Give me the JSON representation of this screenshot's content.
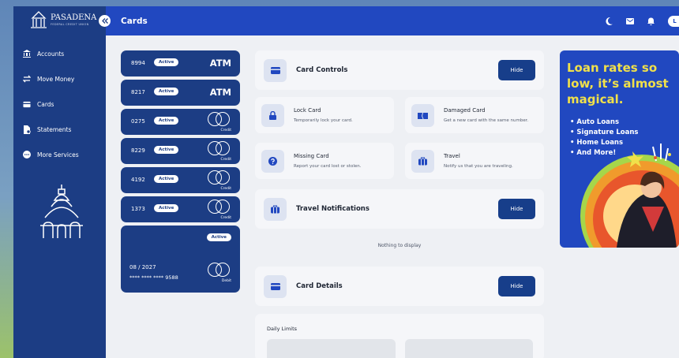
{
  "brand": {
    "name": "PASADENA",
    "tagline": "FEDERAL CREDIT UNION"
  },
  "sidebar": {
    "items": [
      {
        "label": "Accounts",
        "icon": "bank-icon"
      },
      {
        "label": "Move Money",
        "icon": "transfer-icon"
      },
      {
        "label": "Cards",
        "icon": "card-icon"
      },
      {
        "label": "Statements",
        "icon": "statement-icon"
      },
      {
        "label": "More Services",
        "icon": "more-icon"
      }
    ]
  },
  "header": {
    "title": "Cards",
    "icons": [
      "moon-icon",
      "mail-icon",
      "bell-icon",
      "avatar"
    ],
    "avatar_initial": "L"
  },
  "cards": [
    {
      "number": "8994",
      "status": "Active",
      "kind": "ATM"
    },
    {
      "number": "8217",
      "status": "Active",
      "kind": "ATM"
    },
    {
      "number": "0275",
      "status": "Active",
      "kind": "Credit"
    },
    {
      "number": "8229",
      "status": "Active",
      "kind": "Credit"
    },
    {
      "number": "4192",
      "status": "Active",
      "kind": "Credit"
    },
    {
      "number": "1373",
      "status": "Active",
      "kind": "Credit"
    }
  ],
  "selected_card": {
    "status": "Active",
    "expiry": "08 / 2027",
    "masked": "**** **** **** 9588",
    "kind": "Debit"
  },
  "card_controls": {
    "title": "Card Controls",
    "hide": "Hide",
    "options": [
      {
        "title": "Lock Card",
        "subtitle": "Temporarily lock your card.",
        "icon": "lock-icon"
      },
      {
        "title": "Damaged Card",
        "subtitle": "Get a new card with the same number.",
        "icon": "damaged-card-icon"
      },
      {
        "title": "Missing Card",
        "subtitle": "Report your card lost or stolen.",
        "icon": "question-icon"
      },
      {
        "title": "Travel",
        "subtitle": "Notify us that you are traveling.",
        "icon": "luggage-icon"
      }
    ]
  },
  "travel_notifications": {
    "title": "Travel Notifications",
    "hide": "Hide",
    "empty": "Nothing to display"
  },
  "card_details": {
    "title": "Card Details",
    "hide": "Hide",
    "daily_limits": "Daily Limits"
  },
  "ad": {
    "headline": "Loan rates so low, it’s almost magical.",
    "items": [
      "Auto Loans",
      "Signature Loans",
      "Home Loans",
      "And More!"
    ]
  },
  "colors": {
    "navy": "#1c3d84",
    "topbar": "#2148c0",
    "button": "#173e8a",
    "ad_headline": "#f0e04a"
  }
}
